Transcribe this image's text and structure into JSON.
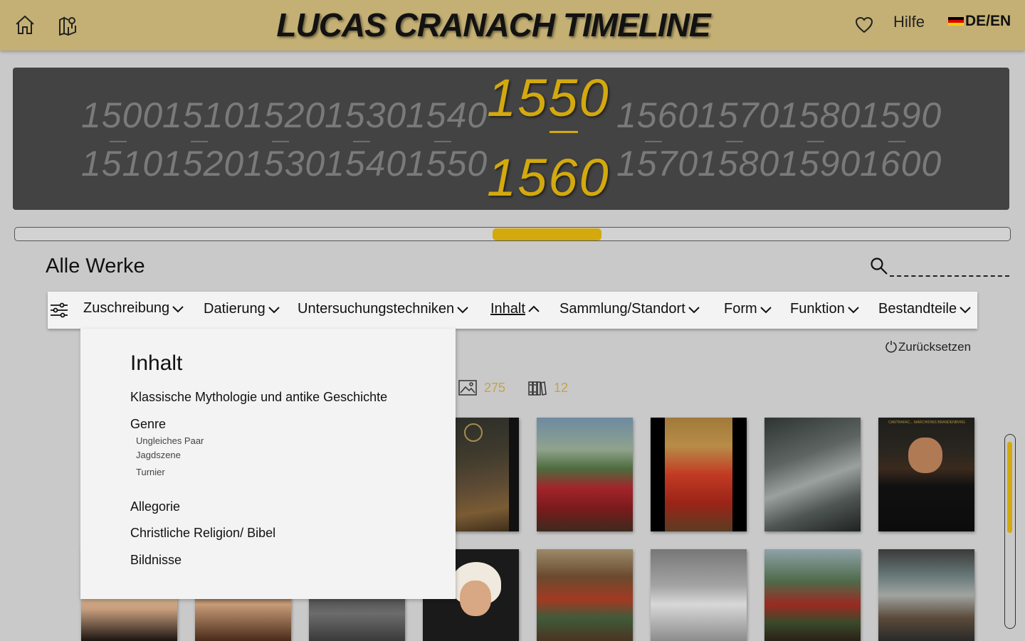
{
  "header": {
    "title": "LUCAS CRANACH TIMELINE",
    "home_icon": "home-icon",
    "map_icon": "map-pin-icon",
    "favorites_icon": "heart-icon",
    "help_label": "Hilfe",
    "language_label": "DE/EN"
  },
  "timeline": {
    "top_years": [
      "1500",
      "1510",
      "1520",
      "1530",
      "1540",
      "1560",
      "1570",
      "1580",
      "1590"
    ],
    "bottom_years": [
      "1510",
      "1520",
      "1530",
      "1540",
      "1550",
      "1570",
      "1580",
      "1590",
      "1600"
    ],
    "selected_start": "1550",
    "selected_end": "1560",
    "slider_start_fraction": 0.48,
    "slider_end_fraction": 0.59
  },
  "section_title": "Alle Werke",
  "search": {
    "placeholder": ""
  },
  "filters": [
    {
      "label": "Zuschreibung",
      "expanded": false
    },
    {
      "label": "Datierung",
      "expanded": false
    },
    {
      "label": "Untersuchungstechniken",
      "expanded": false
    },
    {
      "label": "Inhalt",
      "expanded": true
    },
    {
      "label": "Sammlung/Standort",
      "expanded": false
    },
    {
      "label": "Form",
      "expanded": false
    },
    {
      "label": "Funktion",
      "expanded": false
    },
    {
      "label": "Bestandteile",
      "expanded": false
    }
  ],
  "reset_label": "Zurücksetzen",
  "counts": {
    "paintings": "275",
    "archives": "12"
  },
  "dropdown": {
    "title": "Inhalt",
    "items": [
      {
        "label": "Klassische Mythologie und antike Geschichte"
      },
      {
        "label": "Genre",
        "children": [
          "Ungleiches Paar",
          "Jagdszene",
          "Turnier"
        ]
      },
      {
        "label": "Allegorie"
      },
      {
        "label": "Christliche Religion/ Bibel"
      },
      {
        "label": "Bildnisse"
      }
    ]
  },
  "artworks_row1_caption": "CANTRAFAC... MARCHIONIS BRANDENBVRG",
  "colors": {
    "header_bg": "#c4b074",
    "accent_gold": "#d3a90e",
    "timeline_bg": "#434343",
    "page_bg": "#c9c9c9"
  }
}
